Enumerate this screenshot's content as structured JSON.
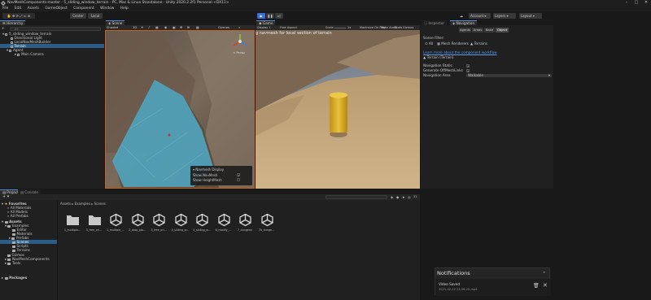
{
  "window": {
    "title": "NavMeshComponents-master - 5_sliding_window_terrain - PC, Mac & Linux Standalone - Unity 2020.2.2f1 Personal <DX11>",
    "min_label": "–",
    "max_label": "□",
    "close_label": "✕"
  },
  "menu": [
    "File",
    "Edit",
    "Assets",
    "GameObject",
    "Component",
    "Window",
    "Help"
  ],
  "toolbar": {
    "pivot_label": "Center",
    "space_label": "Local",
    "account_label": "Account",
    "layers_label": "Layers",
    "layout_label": "Layout"
  },
  "hierarchy": {
    "tab": "Hierarchy",
    "add_label": "+",
    "search_placeholder": "All",
    "items": [
      {
        "label": "5_sliding_window_terrain",
        "indent": 0
      },
      {
        "label": "Directional Light",
        "indent": 1
      },
      {
        "label": "LocalNavMeshBuilder",
        "indent": 1
      },
      {
        "label": "Terrain",
        "indent": 1
      },
      {
        "label": "Agent",
        "indent": 1
      },
      {
        "label": "Main Camera",
        "indent": 2
      }
    ]
  },
  "scene": {
    "tab": "Scene",
    "shading_mode": "Shaded",
    "view_2d": "2D",
    "gizmos": "Gizmos",
    "persp_label": "< Persp",
    "overlay": {
      "title": "Navmesh Display",
      "rows": [
        {
          "label": "Show NavMesh",
          "checked": true
        },
        {
          "label": "Show HeightMesh",
          "checked": false
        }
      ]
    }
  },
  "game": {
    "tab": "Game",
    "display": "Display 1",
    "aspect": "Free Aspect",
    "scale_label": "Scale",
    "scale_value": "1x",
    "maximize": "Maximize On Play",
    "mute": "Mute Audio",
    "stats": "Stats",
    "gizmos": "Gizmos",
    "overlay_text": "g navmesh for local section of terrain"
  },
  "inspector": {
    "tabs": [
      "Inspector",
      "Navigation"
    ],
    "subtabs": [
      "Agents",
      "Areas",
      "Bake",
      "Object"
    ],
    "scene_filter_label": "Scene Filter:",
    "filters": [
      "All",
      "Mesh Renderers",
      "Terrains"
    ],
    "learn_more": "Learn more about the component workflow",
    "object_name": "Terrain (Terrain)",
    "fields": [
      {
        "label": "Navigation Static",
        "type": "check",
        "checked": true
      },
      {
        "label": "Generate OffMeshLinks",
        "type": "check",
        "checked": true
      },
      {
        "label": "Navigation Area",
        "type": "select",
        "value": "Walkable"
      }
    ]
  },
  "project": {
    "tabs": [
      "Project",
      "Console"
    ],
    "breadcrumb": [
      "Assets",
      "Examples",
      "Scenes"
    ],
    "badge": "31",
    "tree": [
      {
        "label": "Favorites",
        "indent": 0,
        "icon": "star",
        "bold": true
      },
      {
        "label": "All Materials",
        "indent": 1,
        "icon": "search"
      },
      {
        "label": "All Models",
        "indent": 1,
        "icon": "search"
      },
      {
        "label": "All Prefabs",
        "indent": 1,
        "icon": "search"
      },
      {
        "label": "Assets",
        "indent": 0,
        "icon": "folder",
        "bold": true
      },
      {
        "label": "Examples",
        "indent": 1,
        "icon": "folder"
      },
      {
        "label": "Editor",
        "indent": 2,
        "icon": "folder"
      },
      {
        "label": "Materials",
        "indent": 2,
        "icon": "folder"
      },
      {
        "label": "Prefabs",
        "indent": 2,
        "icon": "folder"
      },
      {
        "label": "Scenes",
        "indent": 2,
        "icon": "folder",
        "selected": true
      },
      {
        "label": "Scripts",
        "indent": 2,
        "icon": "folder"
      },
      {
        "label": "Terrains",
        "indent": 2,
        "icon": "folder"
      },
      {
        "label": "Gizmos",
        "indent": 1,
        "icon": "folder"
      },
      {
        "label": "NavMeshComponents",
        "indent": 1,
        "icon": "folder"
      },
      {
        "label": "Tools",
        "indent": 1,
        "icon": "folder"
      },
      {
        "label": "Packages",
        "indent": 0,
        "icon": "folder",
        "bold": true
      }
    ],
    "assets": [
      {
        "label": "1_multiple...",
        "type": "folder"
      },
      {
        "label": "5_free_ori...",
        "type": "folder"
      },
      {
        "label": "1_multiple_...",
        "type": "unity"
      },
      {
        "label": "2_drop_pla...",
        "type": "unity"
      },
      {
        "label": "3_free_ori...",
        "type": "unity"
      },
      {
        "label": "4_sliding_w...",
        "type": "unity"
      },
      {
        "label": "5_sliding_w...",
        "type": "unity"
      },
      {
        "label": "6_modify_...",
        "type": "unity"
      },
      {
        "label": "7_dungeon",
        "type": "unity"
      },
      {
        "label": "7b_dunge...",
        "type": "unity"
      }
    ]
  },
  "notification": {
    "header": "Notifications",
    "title": "Video Saved",
    "subtitle": "2021-02-22 22-56-25.mp4"
  },
  "colors": {
    "accent": "#5a8adb",
    "play_active": "#3b6ed6",
    "navmesh": "#4fb7d8",
    "capsule": "#d9a81a",
    "link": "#5b9cf0"
  }
}
